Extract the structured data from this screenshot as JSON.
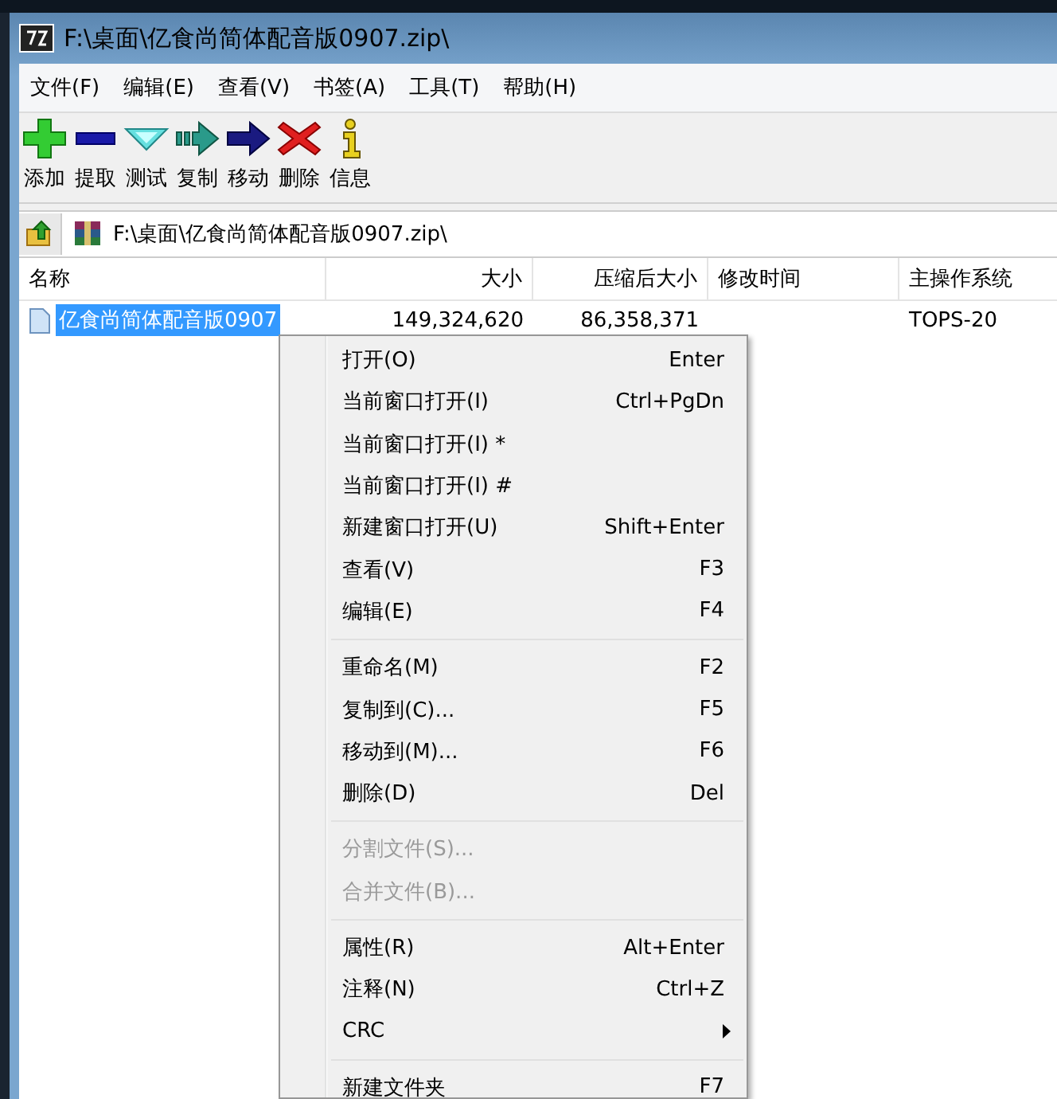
{
  "window": {
    "title": "F:\\桌面\\亿食尚简体配音版0907.zip\\"
  },
  "menu_bar": [
    {
      "label": "文件(F)"
    },
    {
      "label": "编辑(E)"
    },
    {
      "label": "查看(V)"
    },
    {
      "label": "书签(A)"
    },
    {
      "label": "工具(T)"
    },
    {
      "label": "帮助(H)"
    }
  ],
  "toolbar": [
    {
      "label": "添加"
    },
    {
      "label": "提取"
    },
    {
      "label": "测试"
    },
    {
      "label": "复制"
    },
    {
      "label": "移动"
    },
    {
      "label": "删除"
    },
    {
      "label": "信息"
    }
  ],
  "address": {
    "path": "F:\\桌面\\亿食尚简体配音版0907.zip\\"
  },
  "table": {
    "columns": [
      "名称",
      "大小",
      "压缩后大小",
      "修改时间",
      "主操作系统"
    ],
    "rows": [
      {
        "name": "亿食尚简体配音版0907",
        "size": "149,324,620",
        "packed": "86,358,371",
        "host": "TOPS-20",
        "selected": true
      }
    ]
  },
  "context_menu": [
    {
      "kind": "item",
      "label": "打开(O)",
      "shortcut": "Enter",
      "disabled": false
    },
    {
      "kind": "item",
      "label": "当前窗口打开(I)",
      "shortcut": "Ctrl+PgDn",
      "disabled": false
    },
    {
      "kind": "item",
      "label": "当前窗口打开(I) *",
      "disabled": false
    },
    {
      "kind": "item",
      "label": "当前窗口打开(I) #",
      "disabled": false
    },
    {
      "kind": "item",
      "label": "新建窗口打开(U)",
      "shortcut": "Shift+Enter",
      "disabled": false
    },
    {
      "kind": "item",
      "label": "查看(V)",
      "shortcut": "F3",
      "disabled": false
    },
    {
      "kind": "item",
      "label": "编辑(E)",
      "shortcut": "F4",
      "disabled": false
    },
    {
      "kind": "separator"
    },
    {
      "kind": "item",
      "label": "重命名(M)",
      "shortcut": "F2",
      "disabled": false
    },
    {
      "kind": "item",
      "label": "复制到(C)...",
      "shortcut": "F5",
      "disabled": false
    },
    {
      "kind": "item",
      "label": "移动到(M)...",
      "shortcut": "F6",
      "disabled": false
    },
    {
      "kind": "item",
      "label": "删除(D)",
      "shortcut": "Del",
      "disabled": false
    },
    {
      "kind": "separator"
    },
    {
      "kind": "item",
      "label": "分割文件(S)...",
      "disabled": true
    },
    {
      "kind": "item",
      "label": "合并文件(B)...",
      "disabled": true
    },
    {
      "kind": "separator"
    },
    {
      "kind": "item",
      "label": "属性(R)",
      "shortcut": "Alt+Enter",
      "disabled": false
    },
    {
      "kind": "item",
      "label": "注释(N)",
      "shortcut": "Ctrl+Z",
      "disabled": false
    },
    {
      "kind": "submenu",
      "label": "CRC",
      "disabled": false
    },
    {
      "kind": "separator"
    },
    {
      "kind": "item",
      "label": "新建文件夹",
      "shortcut": "F7",
      "disabled": false
    }
  ]
}
